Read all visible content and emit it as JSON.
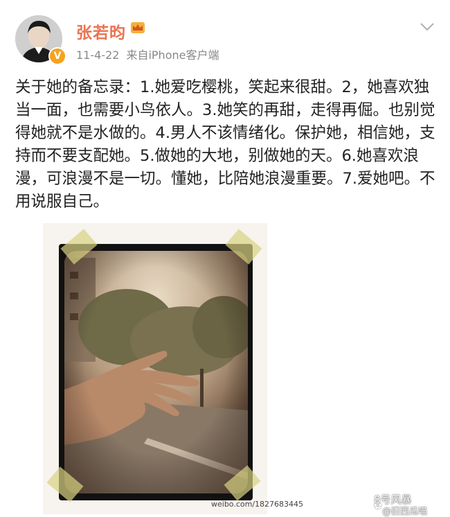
{
  "post": {
    "username": "张若昀",
    "date": "11-4-22",
    "source": "来自iPhone客户端",
    "verified_symbol": "V",
    "text": "关于她的备忘录：1.她爱吃樱桃，笑起来很甜。2，她喜欢独当一面，也需要小鸟依人。3.她笑的再甜，走得再倔。也别觉得她就不是水做的。4.男人不该情绪化。保护她，相信她，支持而不要支配她。5.做她的大地，别做她的天。6.她喜欢浪漫，可浪漫不是一切。懂她，比陪她浪漫重要。7.爱她吧。不用说服自己。"
  },
  "image": {
    "watermark_url": "weibo.com/1827683445",
    "subject": "hand-over-trees-photo"
  },
  "overlay": {
    "brand": "8号风暴",
    "handle": "@旧西瓜喵"
  },
  "colors": {
    "username": "#eb7350",
    "meta": "#888888",
    "verified": "#f7a21b",
    "text": "#222222"
  },
  "icons": [
    "crown-icon",
    "chevron-down-icon",
    "verified-badge-icon",
    "wechat-icon"
  ]
}
